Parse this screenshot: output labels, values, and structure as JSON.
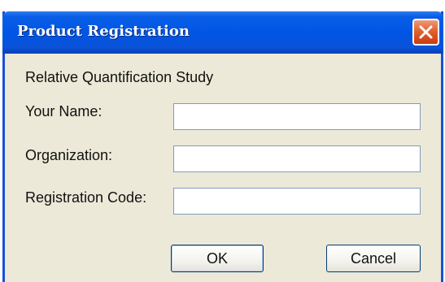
{
  "window": {
    "title": "Product Registration",
    "close_icon": "close-icon"
  },
  "dialog": {
    "heading": "Relative Quantification Study",
    "fields": [
      {
        "label": "Your Name:",
        "value": ""
      },
      {
        "label": "Organization:",
        "value": ""
      },
      {
        "label": "Registration Code:",
        "value": ""
      }
    ]
  },
  "buttons": {
    "ok_label": "OK",
    "cancel_label": "Cancel"
  },
  "colors": {
    "titlebar": "#0055e5",
    "window_border": "#1a4fd6",
    "dialog_background": "#ece9d8",
    "close_button": "#e2622f"
  }
}
